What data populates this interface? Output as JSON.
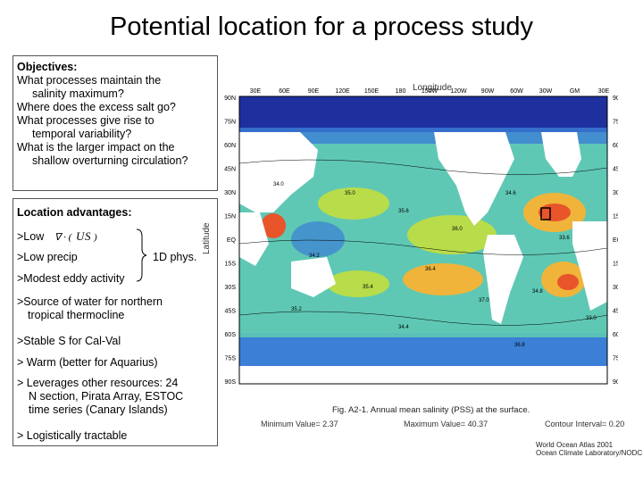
{
  "title": "Potential location for a process study",
  "objectives": {
    "heading": "Objectives:",
    "lines": [
      {
        "text": "What processes maintain the",
        "indent": false
      },
      {
        "text": "salinity maximum?",
        "indent": true
      },
      {
        "text": "Where does the excess salt go?",
        "indent": false
      },
      {
        "text": "What processes give rise to",
        "indent": false
      },
      {
        "text": "temporal variability?",
        "indent": true
      },
      {
        "text": "What is the larger  impact on the",
        "indent": false
      },
      {
        "text": "shallow overturning circulation?",
        "indent": true
      }
    ]
  },
  "advantages": {
    "heading": "Location advantages:",
    "low1": ">Low",
    "low2": ">Low precip",
    "phys": "1D phys.",
    "eddy": ">Modest eddy activity",
    "source1": ">Source of water for northern",
    "source2": "tropical thermocline",
    "stable": ">Stable S for Cal-Val",
    "warm": "> Warm (better for Aquarius)",
    "lev1": "> Leverages other resources: 24",
    "lev2": "N section, Pirata Array, ESTOC",
    "lev3": "time series (Canary Islands)",
    "logist": "> Logistically tractable"
  },
  "map": {
    "longitude_label": "Longitude",
    "latitude_label": "Latitude",
    "lon_ticks": [
      "30E",
      "60E",
      "90E",
      "120E",
      "150E",
      "180",
      "150W",
      "120W",
      "90W",
      "60W",
      "30W",
      "GM",
      "30E"
    ],
    "lat_ticks": [
      "90N",
      "75N",
      "60N",
      "45N",
      "30N",
      "15N",
      "EQ",
      "15S",
      "30S",
      "45S",
      "60S",
      "75S",
      "90S"
    ],
    "caption": "Fig. A2-1.  Annual  mean salinity (PSS) at the surface.",
    "contour": "Contour Interval=  0.20",
    "min": "Minimum Value=  2.37",
    "max": "Maximum Value=  40.37",
    "credit1": "World Ocean Atlas 2001",
    "credit2": "Ocean Climate Laboratory/NODC",
    "contour_labels": [
      "34.0",
      "35.0",
      "35.6",
      "36.0",
      "34.6",
      "33.6",
      "34.2",
      "35.4",
      "36.4",
      "37.0",
      "34.8",
      "33.0",
      "35.2",
      "34.4",
      "36.8"
    ],
    "colors": {
      "land": "#ffffff",
      "low": "#1e2f9e",
      "midlow": "#3b7fd6",
      "mid": "#5fc8b4",
      "midhigh": "#b8dc4a",
      "high": "#f0b43a",
      "max": "#e8552a"
    }
  }
}
